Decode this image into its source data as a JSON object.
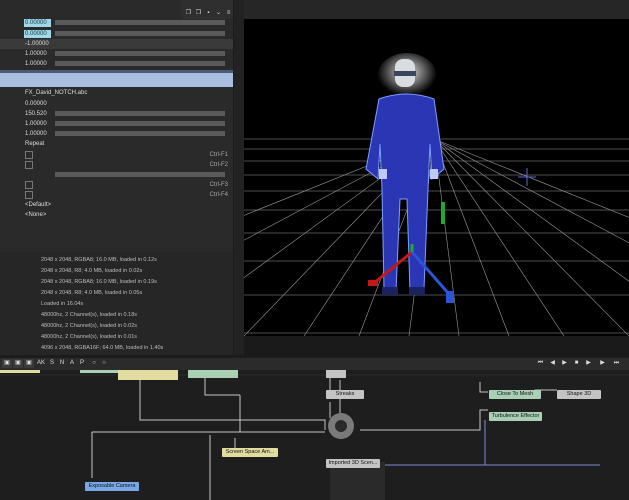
{
  "properties": {
    "row1": {
      "value": "0.00000"
    },
    "row2": {
      "value": "0.00000"
    },
    "row3": {
      "value": "-1.00000"
    },
    "row4": {
      "value": "1.00000"
    },
    "row5": {
      "value": "1.00000"
    },
    "file": {
      "value": "FX_David_NOTCH.abc"
    },
    "row7": {
      "value": "0.00000"
    },
    "row8": {
      "value": "150.520"
    },
    "row9": {
      "value": "1.00000"
    },
    "row10": {
      "value": "1.00000"
    },
    "repeat": {
      "value": "Repeat"
    },
    "shortcuts": [
      "Ctrl-F1",
      "Ctrl-F2",
      "Ctrl-F3",
      "Ctrl-F4"
    ],
    "default_option": "<Default>",
    "none_option": "<None>"
  },
  "log": {
    "lines": [
      "2048 x 2048, RGBA8; 16.0 MB, loaded in 0.12s",
      "2048 x 2048, R8; 4.0 MB, loaded in 0.02s",
      "2048 x 2048, RGBA8; 16.0 MB, loaded in 0.19s",
      "2048 x 2048, R8; 4.0 MB, loaded in 0.05s",
      "Loaded in 16.04s",
      "48000hz, 2 Channel(s), loaded in 0.18s",
      "48000hz, 2 Channel(s), loaded in 0.02s",
      "48000hz, 2 Channel(s), loaded in 0.01s",
      "4096 x 2048, RGBA16F; 64.0 MB, loaded in 1.40s"
    ]
  },
  "toolbar": {
    "buttons": [
      "AK",
      "S",
      "N",
      "A",
      "P"
    ]
  },
  "nodes": {
    "streaks": "Streaks",
    "close_to_mesh": "Close To Mesh",
    "shape_3d": "Shape 3D",
    "turbulence_effector": "Turbulence Effector",
    "screen_space": "Screen Space Am...",
    "imported_3d": "Imported 3D Scen...",
    "exposable_camera": "Exposable Camera"
  },
  "colors": {
    "accent_cyan": "#9fd8e8",
    "node_green": "#a9cfb4",
    "node_yellow": "#e2dca0",
    "node_blue": "#7aa7e6",
    "node_grey": "#c4c4c4"
  }
}
